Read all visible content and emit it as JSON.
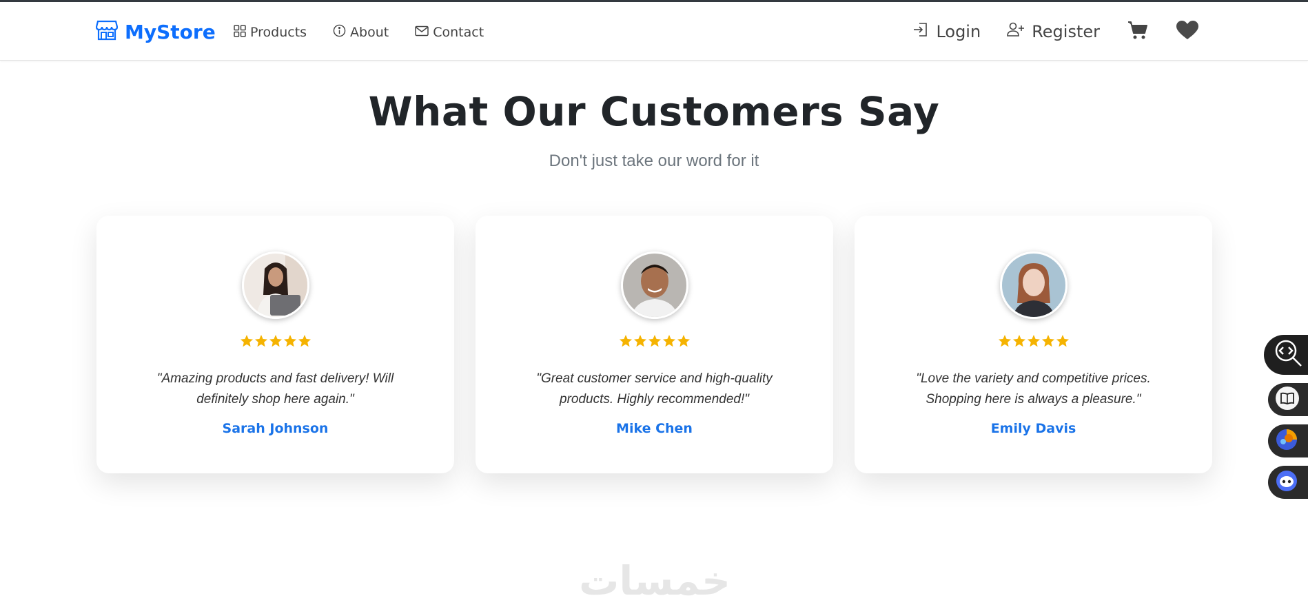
{
  "nav": {
    "brand": "MyStore",
    "links": [
      {
        "label": "Products",
        "icon": "grid-icon"
      },
      {
        "label": "About",
        "icon": "info-icon"
      },
      {
        "label": "Contact",
        "icon": "envelope-icon"
      }
    ],
    "login": "Login",
    "register": "Register"
  },
  "section": {
    "title": "What Our Customers Say",
    "subtitle": "Don't just take our word for it"
  },
  "testimonials": [
    {
      "quote": "\"Amazing products and fast delivery! Will definitely shop here again.\"",
      "name": "Sarah Johnson",
      "rating": 5
    },
    {
      "quote": "\"Great customer service and high-quality products. Highly recommended!\"",
      "name": "Mike Chen",
      "rating": 5
    },
    {
      "quote": "\"Love the variety and competitive prices. Shopping here is always a pleasure.\"",
      "name": "Emily Davis",
      "rating": 5
    }
  ],
  "watermark": "خمسات",
  "colors": {
    "brand": "#0d6efd",
    "name": "#1a73e8",
    "star": "#f5b301"
  }
}
